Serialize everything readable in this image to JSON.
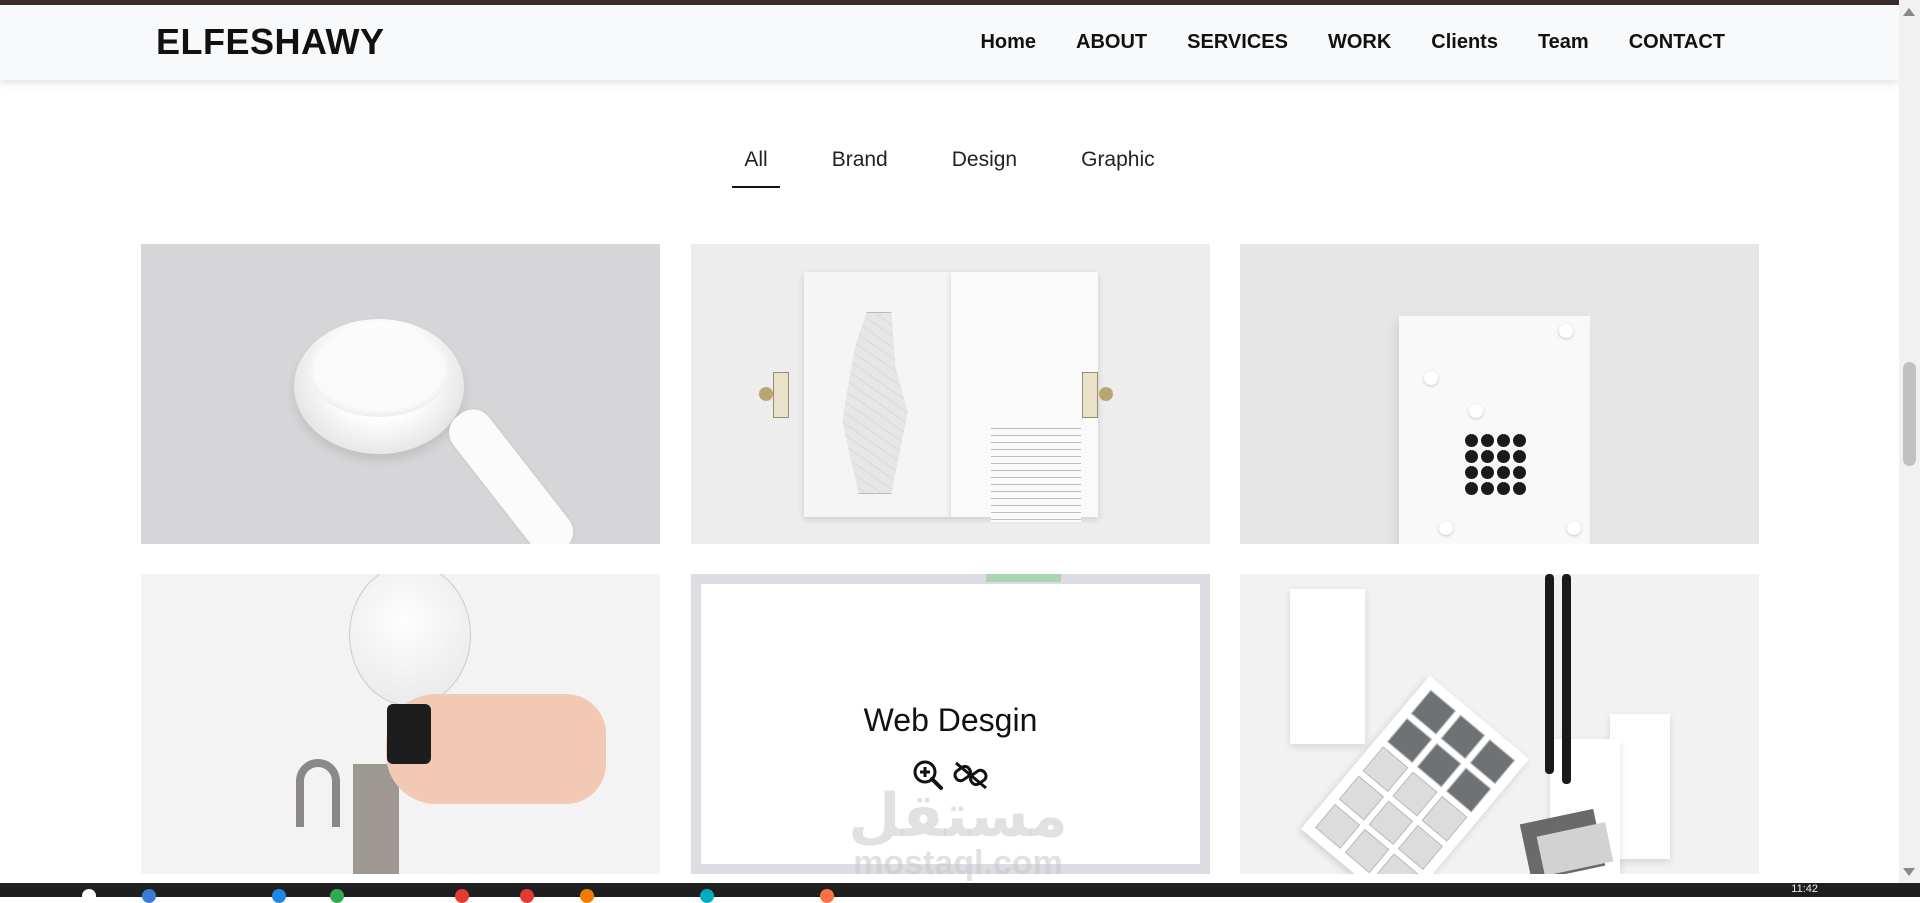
{
  "brand": "ELFESHAWY",
  "nav": [
    "Home",
    "ABOUT",
    "SERVICES",
    "WORK",
    "Clients",
    "Team",
    "CONTACT"
  ],
  "filters": [
    "All",
    "Brand",
    "Design",
    "Graphic"
  ],
  "active_filter": "All",
  "portfolio": {
    "hover_item_title": "Web Desgin",
    "icons": [
      "zoom-in-icon",
      "unlink-icon"
    ]
  },
  "watermark": {
    "arabic": "مستقل",
    "latin": "mostaql.com"
  },
  "taskbar": {
    "time": "11:42"
  },
  "colors": {
    "topline": "#3b2d2e",
    "navbar": "#f8f9fa",
    "text": "#111111"
  }
}
